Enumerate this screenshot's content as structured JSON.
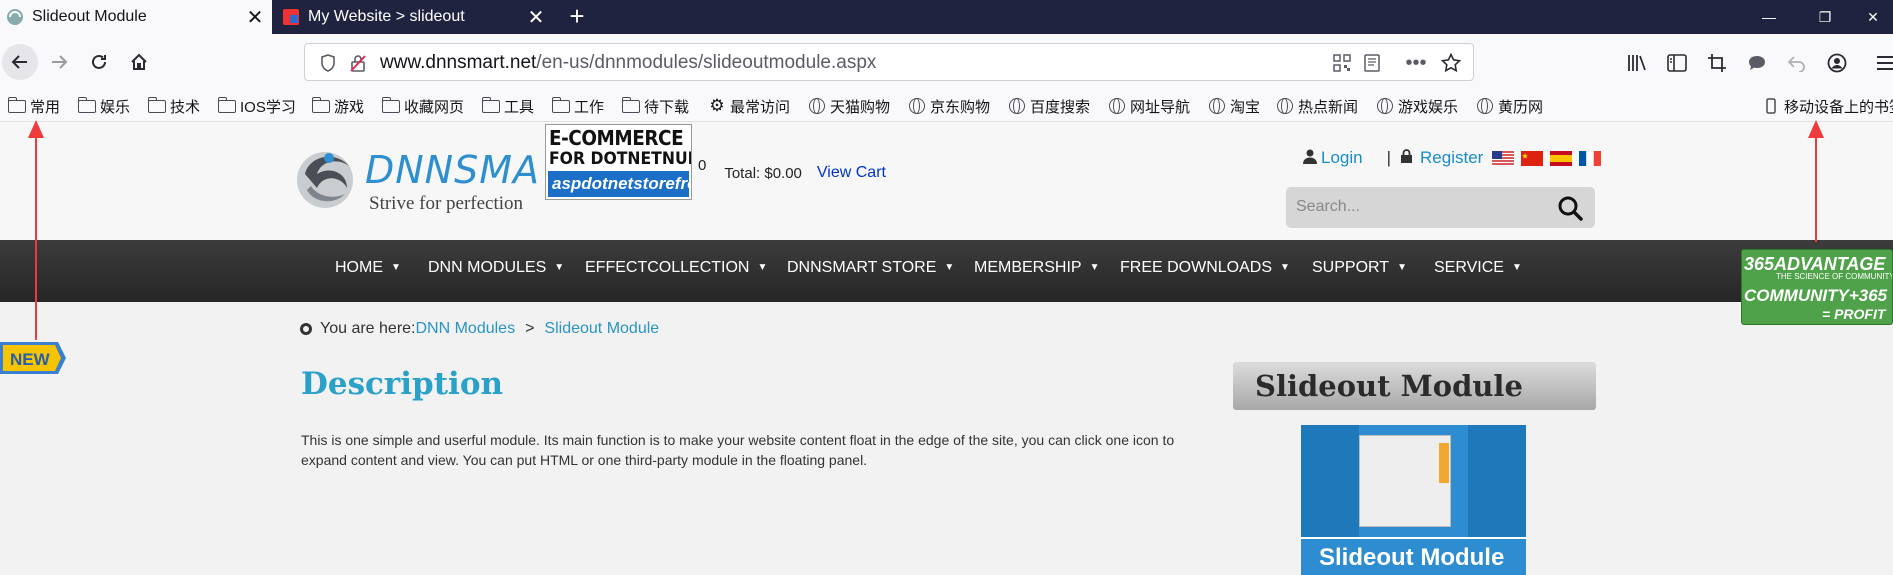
{
  "browser": {
    "tabs": [
      {
        "title": "Slideout Module",
        "active": true
      },
      {
        "title": "My Website > slideout",
        "active": false
      }
    ],
    "url": {
      "domain": "www.dnnsmart.net",
      "path": "/en-us/dnnmodules/slideoutmodule.aspx"
    },
    "bookmarks": {
      "folders": [
        "常用",
        "娱乐",
        "技术",
        "IOS学习",
        "游戏",
        "收藏网页",
        "工具",
        "工作",
        "待下载"
      ],
      "links": [
        "最常访问",
        "天猫购物",
        "京东购物",
        "百度搜索",
        "网址导航",
        "淘宝",
        "热点新闻",
        "游戏娱乐",
        "黄历网"
      ],
      "mobile": "移动设备上的书签"
    }
  },
  "site": {
    "logo": {
      "brand": "DNNSMA",
      "tagline": "Strive for perfection"
    },
    "ecommerce_banner": {
      "line1": "E-COMMERCE",
      "line2": "FOR DOTNETNUKE",
      "line3": "aspdotnetstorefront"
    },
    "cart": {
      "count": "0",
      "total": "Total: $0.00",
      "view_cart": "View Cart"
    },
    "user": {
      "login": "Login",
      "separator": "|",
      "register": "Register"
    },
    "search": {
      "placeholder": "Search..."
    },
    "menu": [
      {
        "label": "HOME"
      },
      {
        "label": "DNN MODULES"
      },
      {
        "label": "EFFECTCOLLECTION"
      },
      {
        "label": "DNNSMART STORE"
      },
      {
        "label": "MEMBERSHIP"
      },
      {
        "label": "FREE DOWNLOADS"
      },
      {
        "label": "SUPPORT"
      },
      {
        "label": "SERVICE"
      }
    ],
    "breadcrumb": {
      "prefix": "You are here:",
      "items": [
        "DNN Modules",
        "Slideout Module"
      ],
      "separator": ">"
    },
    "description": {
      "title": "Description",
      "text": "This is one simple and userful module. Its main function is to make your website content float in the edge of the site, you can click one icon to expand content and view. You can put HTML or one third-party module in the floating panel."
    },
    "sidebar": {
      "title": "Slideout Module",
      "thumb_caption": "Slideout Module"
    },
    "new_badge": "NEW",
    "ad365": {
      "line1": "365ADVANTAGE",
      "line2": "THE SCIENCE OF COMMUNITY",
      "line3": "COMMUNITY+365",
      "line4": "= PROFIT"
    }
  },
  "colors": {
    "accent": "#2aa1c8",
    "menu_bg": "#2e2e2e",
    "link": "#2a94c4",
    "tabbar": "#202340",
    "arrow": "#ee3a3a"
  }
}
